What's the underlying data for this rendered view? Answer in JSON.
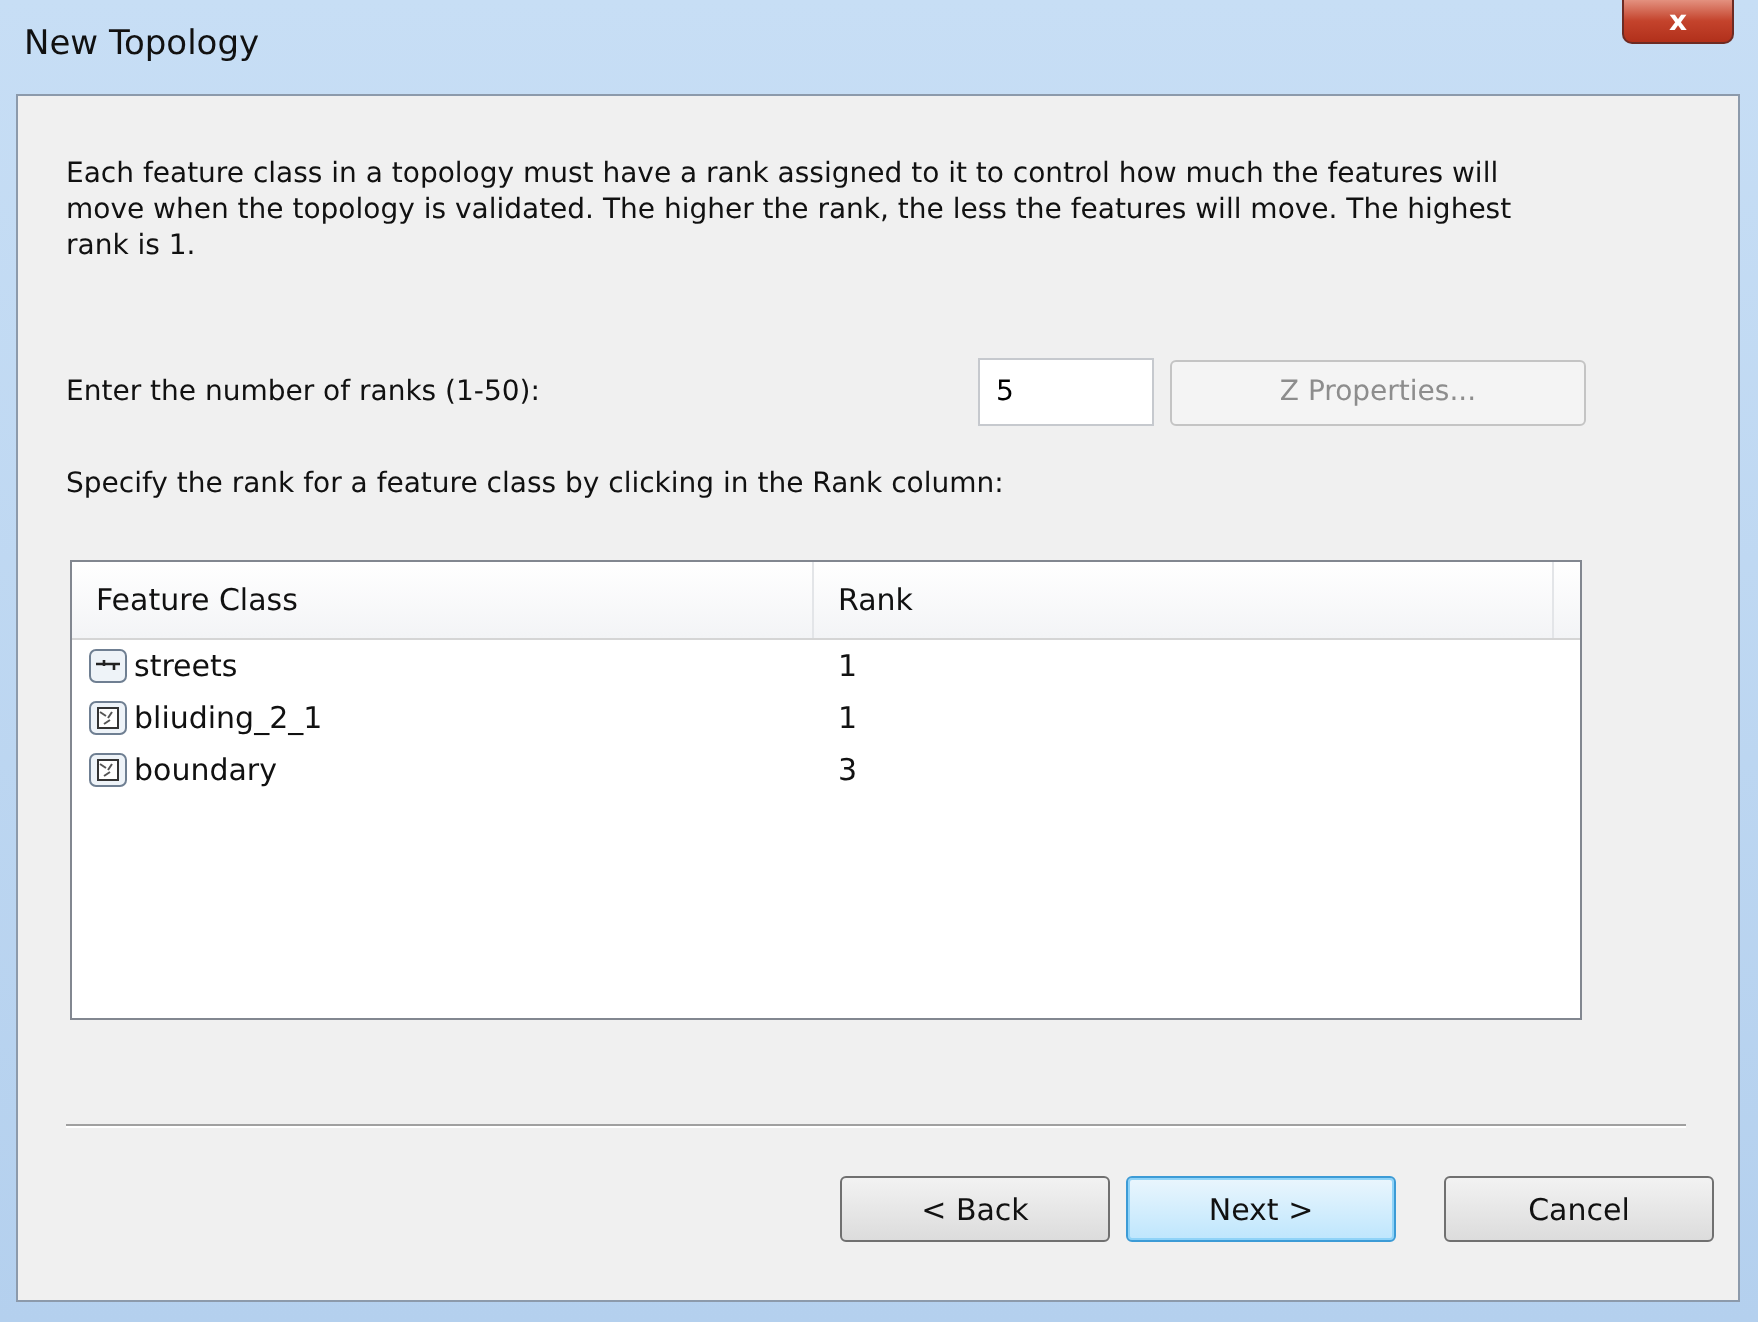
{
  "window": {
    "title": "New Topology",
    "close": "x"
  },
  "intro": "Each feature class in a topology must have a rank assigned to it to control how much the features will move when the topology is validated. The higher the rank, the less the features will move. The highest rank is 1.",
  "ranks": {
    "label": "Enter the number of ranks  (1-50):",
    "value": "5",
    "button": {
      "label": "Z Properties...",
      "disabled": true
    }
  },
  "instruction": "Specify the rank for a feature class by clicking in the Rank column:",
  "table": {
    "columns": [
      "Feature Class",
      "Rank"
    ],
    "rows": [
      {
        "kind": "line",
        "name": "streets",
        "rank": "1"
      },
      {
        "kind": "polygon",
        "name": "bliuding_2_1",
        "rank": "1"
      },
      {
        "kind": "polygon",
        "name": "boundary",
        "rank": "3"
      }
    ]
  },
  "buttons": [
    {
      "label": "< Back",
      "default": false
    },
    {
      "label": "Next >",
      "default": true
    },
    {
      "label": "Cancel",
      "default": false
    }
  ]
}
